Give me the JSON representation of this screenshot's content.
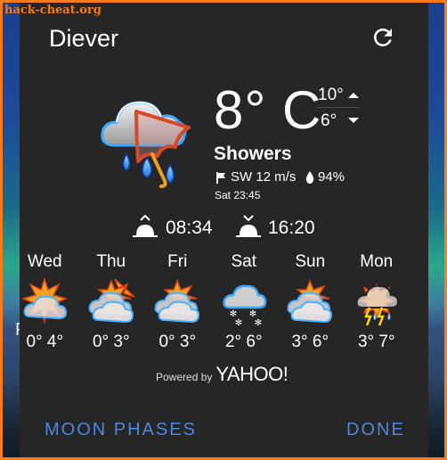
{
  "watermark": "hack-cheat.org",
  "background": {
    "partial_text": "F",
    "dots": "••"
  },
  "dialog": {
    "location": "Diever",
    "refresh_icon": "refresh-icon",
    "current": {
      "temperature": "8°",
      "unit": "C",
      "high": "10°",
      "low": "6°",
      "condition": "Showers",
      "condition_icon": "showers-umbrella-icon",
      "wind": "SW 12 m/s",
      "humidity": "94%",
      "updated": "Sat 23:45"
    },
    "sun": {
      "sunrise": "08:34",
      "sunset": "16:20"
    },
    "forecast": [
      {
        "day": "Wed",
        "low": "0°",
        "high": "4°",
        "icon": "partly-cloudy-sun-icon"
      },
      {
        "day": "Thu",
        "low": "0°",
        "high": "3°",
        "icon": "mostly-cloudy-sun-icon"
      },
      {
        "day": "Fri",
        "low": "0°",
        "high": "3°",
        "icon": "mostly-cloudy-sun-icon"
      },
      {
        "day": "Sat",
        "low": "2°",
        "high": "6°",
        "icon": "snow-cloud-icon"
      },
      {
        "day": "Sun",
        "low": "3°",
        "high": "6°",
        "icon": "mostly-cloudy-sun-icon"
      },
      {
        "day": "Mon",
        "low": "3°",
        "high": "7°",
        "icon": "thunderstorm-icon"
      }
    ],
    "powered_by": "Powered by",
    "provider": "YAHOO!",
    "buttons": {
      "moon_phases": "MOON PHASES",
      "done": "DONE"
    },
    "colors": {
      "accent": "#4d86e0",
      "dialog_bg": "#262626",
      "frame": "#ff7a1a"
    }
  }
}
